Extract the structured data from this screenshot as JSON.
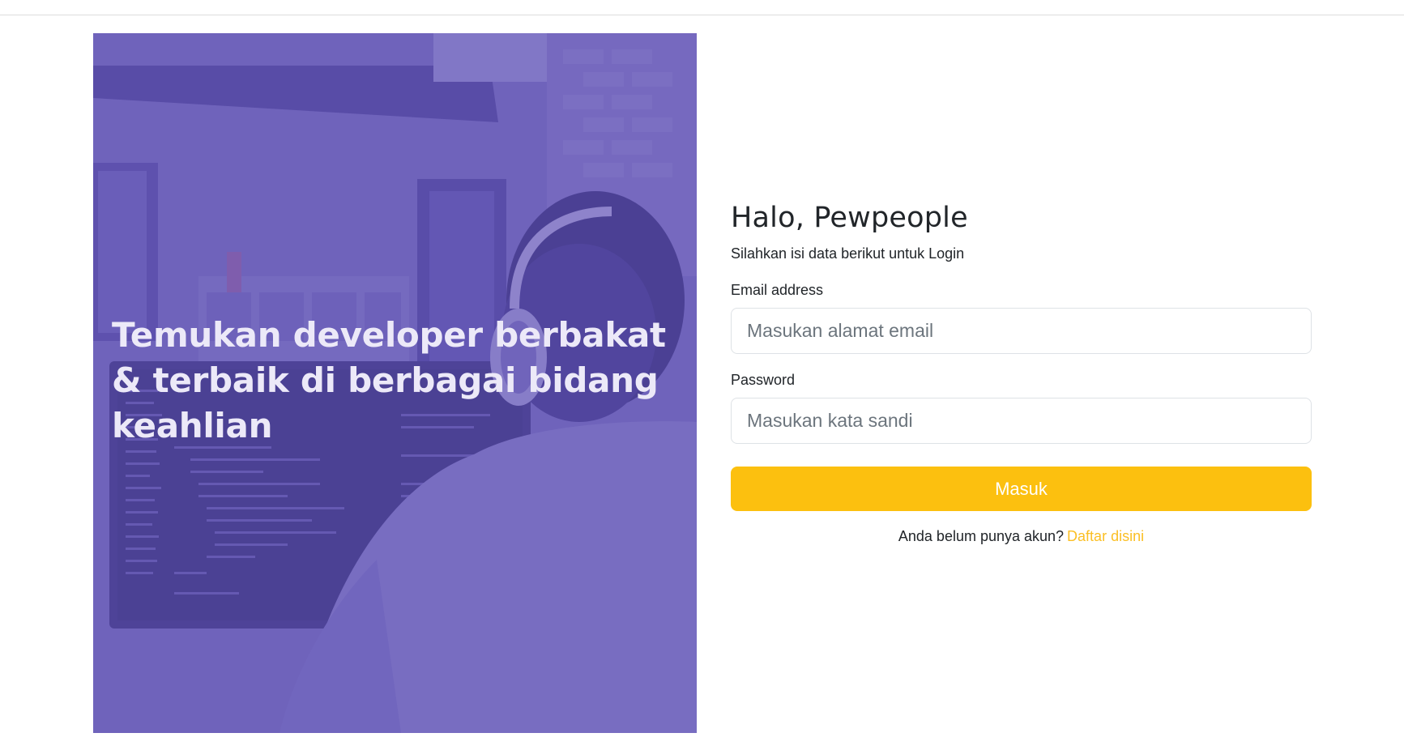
{
  "hero": {
    "headline": "Temukan developer berbakat & terbaik di berbagai bidang keahlian"
  },
  "login": {
    "title": "Halo, Pewpeople",
    "subtitle": "Silahkan isi data berikut untuk Login",
    "email_label": "Email address",
    "email_placeholder": "Masukan alamat email",
    "email_value": "",
    "password_label": "Password",
    "password_placeholder": "Masukan kata sandi",
    "password_value": "",
    "submit_label": "Masuk",
    "signup_prompt": "Anda belum punya akun?",
    "signup_link": "Daftar disini"
  },
  "colors": {
    "hero_overlay": "#6052b4",
    "primary_button": "#fcc00f",
    "link": "#fbbf24",
    "text": "#212529",
    "input_border": "#dee2e6"
  },
  "icons": {
    "hero_image": "developer-with-headphones-photo"
  }
}
